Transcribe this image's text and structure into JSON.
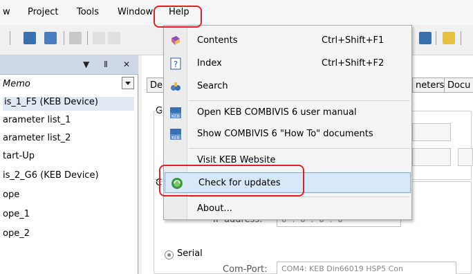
{
  "menubar": {
    "items": [
      {
        "label": "w"
      },
      {
        "label": "Project"
      },
      {
        "label": "Tools"
      },
      {
        "label": "Window"
      },
      {
        "label": "Help"
      }
    ]
  },
  "left_panel": {
    "header_controls": [
      "▼",
      "Ⅱ",
      "✕"
    ],
    "items": [
      {
        "label": "Memo"
      },
      {
        "label": "is_1_F5 (KEB Device)"
      },
      {
        "label": "arameter list_1"
      },
      {
        "label": "arameter list_2"
      },
      {
        "label": "tart-Up"
      },
      {
        "label": "is_2_G6 (KEB Device)"
      },
      {
        "label": "ope"
      },
      {
        "label": "ope_1"
      },
      {
        "label": "ope_2"
      }
    ]
  },
  "content": {
    "tabs": [
      {
        "label": "De"
      },
      {
        "label": "neters"
      },
      {
        "label": "Docu"
      }
    ],
    "group_letters": [
      "G",
      "C"
    ],
    "ip_label": "IP-address:",
    "ip_value": "0 . 0 . 0 . 0",
    "serial_label": "Serial",
    "comport_label": "Com-Port:",
    "comport_value": "COM4: KEB Din66019 HSP5 Con"
  },
  "help_menu": {
    "items": [
      {
        "label": "Contents",
        "shortcut": "Ctrl+Shift+F1",
        "icon": "book-icon"
      },
      {
        "label": "Index",
        "shortcut": "Ctrl+Shift+F2",
        "icon": "question-icon"
      },
      {
        "label": "Search",
        "shortcut": "",
        "icon": "search-binoculars-icon"
      },
      {
        "label": "Open KEB COMBIVIS 6 user manual",
        "shortcut": "",
        "icon": "keb-manual-icon"
      },
      {
        "label": "Show COMBIVIS 6 \"How To\" documents",
        "shortcut": "",
        "icon": "keb-howto-icon"
      },
      {
        "label": "Visit KEB Website",
        "shortcut": "",
        "icon": ""
      },
      {
        "label": "Check for updates",
        "shortcut": "",
        "icon": "update-globe-icon"
      },
      {
        "label": "About...",
        "shortcut": "",
        "icon": ""
      }
    ]
  },
  "colors": {
    "annotation": "#e02020",
    "highlight": "#d8e8f8",
    "panel_header": "#cfd8e6"
  }
}
